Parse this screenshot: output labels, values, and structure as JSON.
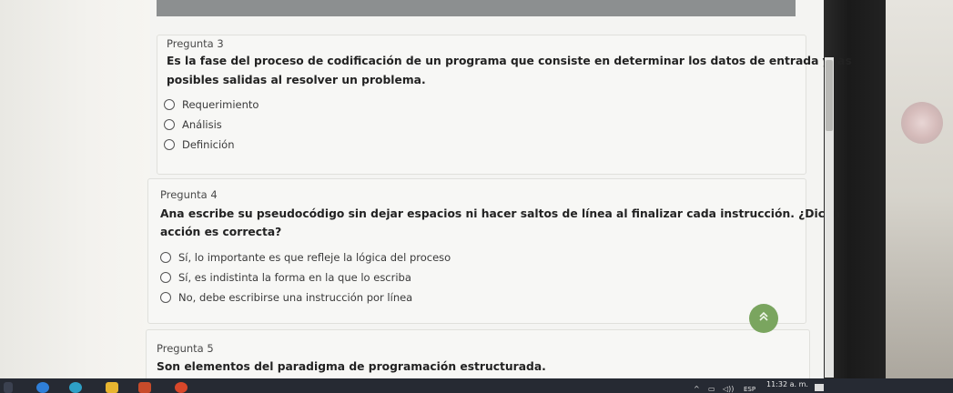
{
  "questions": [
    {
      "number": "Pregunta 3",
      "text_line1": "Es la fase del proceso de codificación de un programa que consiste en determinar los datos de entrada y las",
      "text_line2": "posibles salidas al resolver un problema.",
      "options": [
        "Requerimiento",
        "Análisis",
        "Definición"
      ]
    },
    {
      "number": "Pregunta 4",
      "text_line1": "Ana escribe su pseudocódigo sin dejar espacios ni hacer saltos de línea al finalizar cada instrucción. ¿Dicha",
      "text_line2": "acción es correcta?",
      "options": [
        "Sí, lo importante es que refleje la lógica del proceso",
        "Sí, es indistinta la forma en la que lo escriba",
        "No, debe escribirse una instrucción por línea"
      ]
    },
    {
      "number": "Pregunta 5",
      "text_line1": "Son elementos del paradigma de programación estructurada."
    }
  ],
  "scroll_top_button": {
    "icon": "double-chevron-up-icon",
    "glyph": "⌃",
    "color": "#7aa55f"
  },
  "taskbar": {
    "time": "11:32 a. m.",
    "language": "ESP",
    "tray_up": "^",
    "volume": "◁))"
  }
}
